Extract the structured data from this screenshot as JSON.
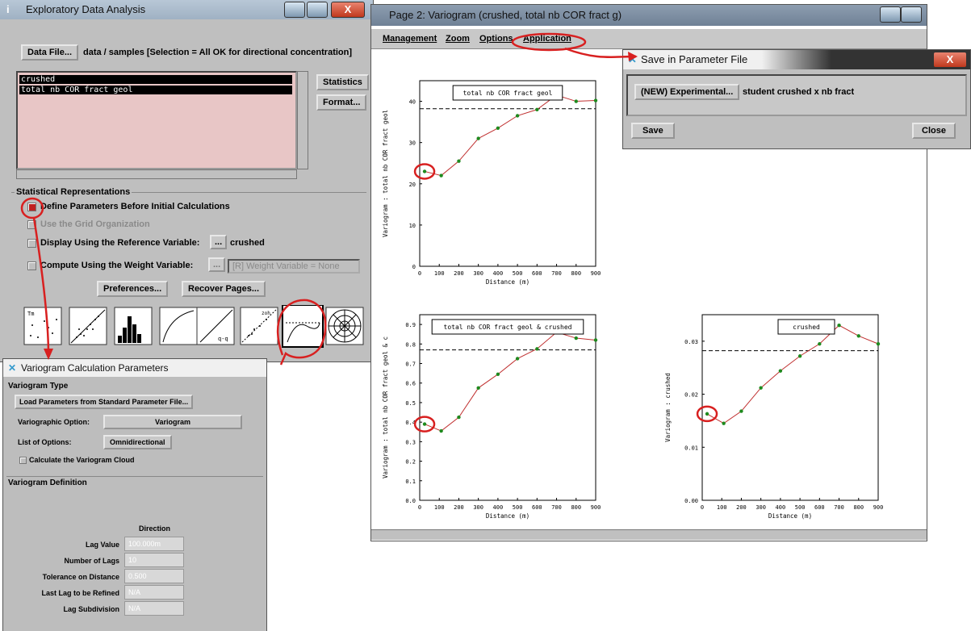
{
  "eda": {
    "title": "Exploratory Data Analysis",
    "data_file_button": "Data File...",
    "data_path": "data / samples [Selection = All OK for directional concentration]",
    "variables": [
      "crushed",
      "total nb COR fract geol"
    ],
    "statistics_button": "Statistics",
    "format_button": "Format...",
    "section_label": "Statistical Representations",
    "opt_define": "Define Parameters Before Initial Calculations",
    "opt_grid": "Use the Grid Organization",
    "opt_display": "Display Using the Reference Variable:",
    "ellipsis": "...",
    "display_value": "crushed",
    "opt_compute": "Compute Using the Weight Variable:",
    "weight_value": "[R] Weight Variable = None",
    "preferences_button": "Preferences...",
    "recover_button": "Recover Pages...",
    "tool_icons": [
      "basemap-icon",
      "scatter-plot-icon",
      "histogram-icon",
      "cumulative-curve-icon",
      "qq-plot-icon",
      "h-scatter-icon",
      "variogram-icon",
      "variogram-map-icon"
    ]
  },
  "page2": {
    "title": "Page 2: Variogram (crushed, total nb COR fract g)",
    "menu": [
      "Management",
      "Zoom",
      "Options",
      "Application"
    ]
  },
  "save_dialog": {
    "title": "Save in Parameter File",
    "new_button": "(NEW) Experimental...",
    "file_name": "student crushed x nb fract",
    "save_button": "Save",
    "close_button": "Close"
  },
  "vario_params": {
    "title": "Variogram Calculation Parameters",
    "section_type": "Variogram Type",
    "load_button": "Load Parameters from Standard Parameter File...",
    "option_label": "Variographic Option:",
    "option_value": "Variogram",
    "list_label": "List of Options:",
    "list_value": "Omnidirectional",
    "cloud_label": "Calculate the Variogram Cloud",
    "section_def": "Variogram Definition",
    "direction_header": "Direction",
    "rows": [
      {
        "label": "Lag Value",
        "value": "100.000m"
      },
      {
        "label": "Number of Lags",
        "value": "10"
      },
      {
        "label": "Tolerance on Distance",
        "value": "0.500"
      },
      {
        "label": "Last Lag to be Refined",
        "value": "N/A"
      },
      {
        "label": "Lag Subdivision",
        "value": "N/A"
      }
    ]
  },
  "colors": {
    "annotation": "#d82020",
    "curve": "#c03030",
    "points": "#1e8a1e",
    "list_bg": "#e8c6c6",
    "selection": "#000000"
  },
  "chart_data": [
    {
      "type": "line",
      "legend": "total nb COR fract geol",
      "ylabel": "Variogram : total nb COR fract geol",
      "xlabel": "Distance (m)",
      "xlim": [
        0,
        900
      ],
      "ylim": [
        0,
        45
      ],
      "xticks": [
        "0",
        "100",
        "200",
        "300",
        "400",
        "500",
        "600",
        "700",
        "800",
        "900"
      ],
      "yticks": [
        "0",
        "10",
        "20",
        "30",
        "40"
      ],
      "x": [
        25,
        110,
        200,
        300,
        400,
        500,
        600,
        700,
        800,
        900
      ],
      "y": [
        23,
        22,
        25.5,
        31,
        33.5,
        36.5,
        38,
        41.5,
        40,
        40.2
      ],
      "sill": 38.2
    },
    {
      "type": "line",
      "legend": "total nb COR fract geol & crushed",
      "ylabel": "Variogram : total nb COR fract geol & c",
      "xlabel": "Distance (m)",
      "xlim": [
        0,
        900
      ],
      "ylim": [
        0,
        0.95
      ],
      "xticks": [
        "0",
        "100",
        "200",
        "300",
        "400",
        "500",
        "600",
        "700",
        "800",
        "900"
      ],
      "yticks": [
        "0.0",
        "0.1",
        "0.2",
        "0.3",
        "0.4",
        "0.5",
        "0.6",
        "0.7",
        "0.8",
        "0.9"
      ],
      "x": [
        25,
        110,
        200,
        300,
        400,
        500,
        600,
        700,
        800,
        900
      ],
      "y": [
        0.39,
        0.355,
        0.425,
        0.575,
        0.645,
        0.725,
        0.775,
        0.86,
        0.83,
        0.82
      ],
      "sill": 0.77
    },
    {
      "type": "line",
      "legend": "crushed",
      "ylabel": "Variogram : crushed",
      "xlabel": "Distance (m)",
      "xlim": [
        0,
        900
      ],
      "ylim": [
        0,
        0.035
      ],
      "xticks": [
        "0",
        "100",
        "200",
        "300",
        "400",
        "500",
        "600",
        "700",
        "800",
        "900"
      ],
      "yticks": [
        "0.00",
        "0.01",
        "0.02",
        "0.03"
      ],
      "x": [
        25,
        110,
        200,
        300,
        400,
        500,
        600,
        700,
        800,
        900
      ],
      "y": [
        0.0163,
        0.0145,
        0.0168,
        0.0212,
        0.0244,
        0.0272,
        0.0295,
        0.033,
        0.031,
        0.0295
      ],
      "sill": 0.0282
    }
  ]
}
